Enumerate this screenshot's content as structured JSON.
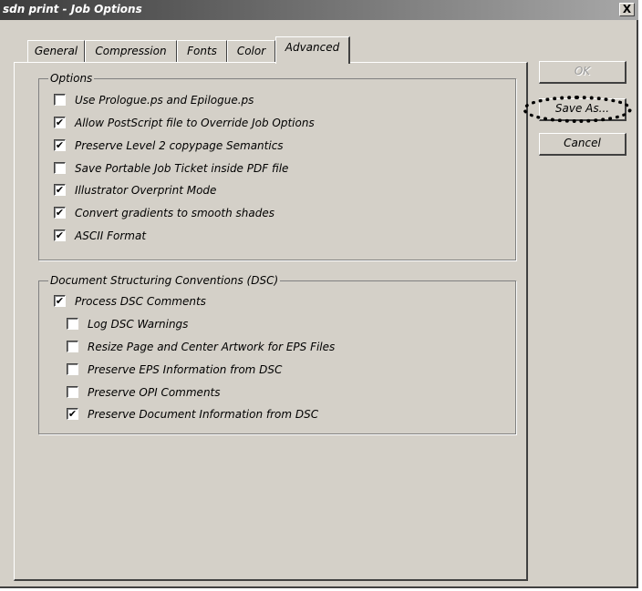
{
  "window": {
    "title": "sdn print - Job Options",
    "close_label": "X"
  },
  "tabs": [
    {
      "label": "General",
      "active": false
    },
    {
      "label": "Compression",
      "active": false
    },
    {
      "label": "Fonts",
      "active": false
    },
    {
      "label": "Color",
      "active": false
    },
    {
      "label": "Advanced",
      "active": true
    }
  ],
  "options_group": {
    "label": "Options",
    "items": [
      {
        "label": "Use Prologue.ps and Epilogue.ps",
        "checked": false
      },
      {
        "label": "Allow PostScript file to Override Job Options",
        "checked": true
      },
      {
        "label": "Preserve Level 2 copypage Semantics",
        "checked": true
      },
      {
        "label": "Save Portable Job Ticket inside PDF file",
        "checked": false
      },
      {
        "label": "Illustrator Overprint Mode",
        "checked": true
      },
      {
        "label": "Convert gradients to smooth shades",
        "checked": true
      },
      {
        "label": "ASCII Format",
        "checked": true
      }
    ]
  },
  "dsc_group": {
    "label": "Document Structuring Conventions (DSC)",
    "process": {
      "label": "Process DSC Comments",
      "checked": true
    },
    "items": [
      {
        "label": "Log DSC Warnings",
        "checked": false
      },
      {
        "label": "Resize Page and Center Artwork for EPS Files",
        "checked": false
      },
      {
        "label": "Preserve EPS Information from DSC",
        "checked": false
      },
      {
        "label": "Preserve OPI Comments",
        "checked": false
      },
      {
        "label": "Preserve Document Information from DSC",
        "checked": true
      }
    ]
  },
  "buttons": {
    "ok": "OK",
    "save_as": "Save As...",
    "cancel": "Cancel"
  },
  "check_glyph": "✔"
}
